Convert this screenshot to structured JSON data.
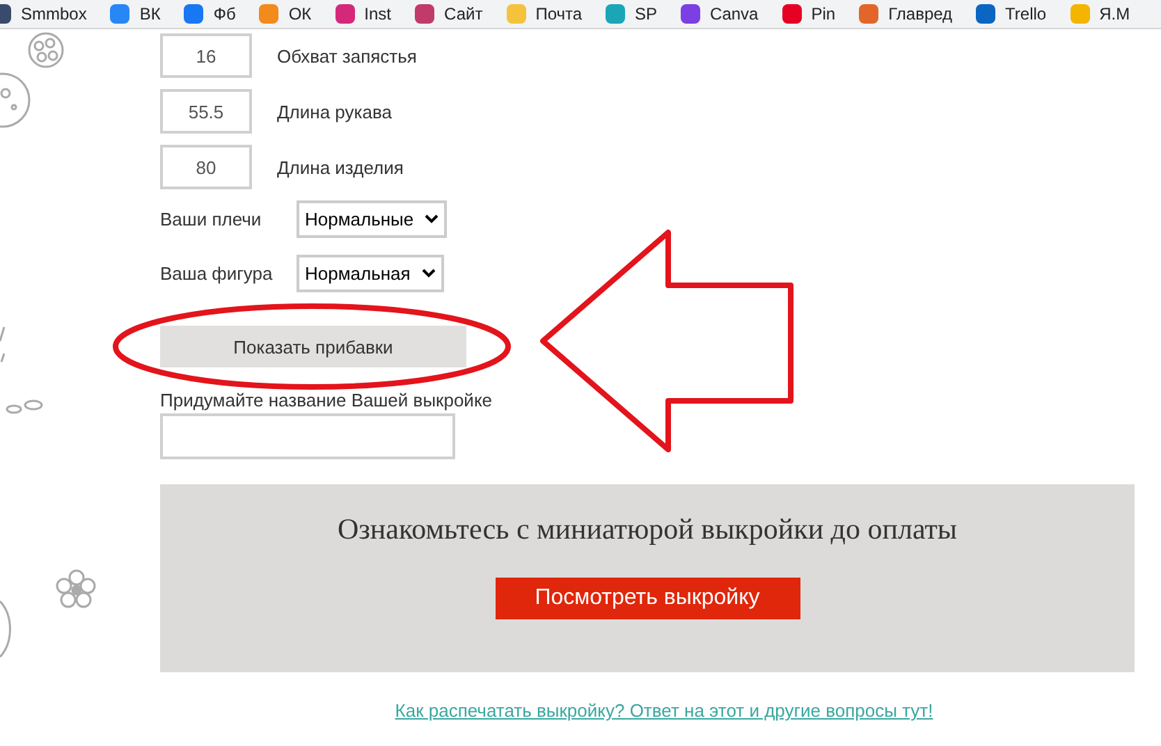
{
  "bookmarks": [
    {
      "label": "Smmbox"
    },
    {
      "label": "ВК"
    },
    {
      "label": "Фб"
    },
    {
      "label": "ОК"
    },
    {
      "label": "Inst"
    },
    {
      "label": "Сайт"
    },
    {
      "label": "Почта"
    },
    {
      "label": "SP"
    },
    {
      "label": "Canva"
    },
    {
      "label": "Pin"
    },
    {
      "label": "Главред"
    },
    {
      "label": "Trello"
    },
    {
      "label": "Я.М"
    }
  ],
  "measurements": [
    {
      "value": "16",
      "label": "Обхват запястья"
    },
    {
      "value": "55.5",
      "label": "Длина рукава"
    },
    {
      "value": "80",
      "label": "Длина изделия"
    }
  ],
  "options": [
    {
      "label": "Ваши плечи",
      "value": "Нормальные"
    },
    {
      "label": "Ваша фигура",
      "value": "Нормальная"
    }
  ],
  "show_button": "Показать прибавки",
  "name_field": {
    "label": "Придумайте название Вашей выкройке"
  },
  "preview": {
    "title": "Ознакомьтесь с миниатюрой выкройки до оплаты",
    "button": "Посмотреть выкройку"
  },
  "help_link": "Как распечатать выкройку? Ответ на этот и другие вопросы тут!"
}
